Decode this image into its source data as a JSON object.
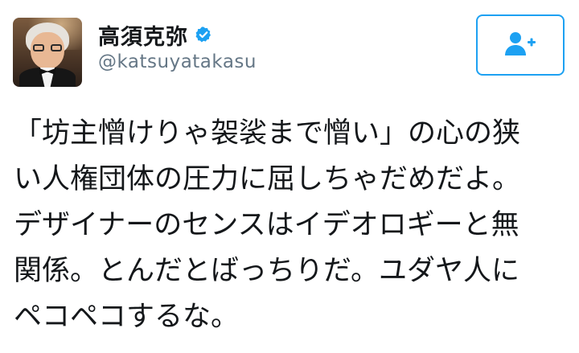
{
  "user": {
    "display_name": "高須克弥",
    "handle": "@katsuyatakasu",
    "verified": true,
    "avatar_icon": "profile-photo"
  },
  "follow_button": {
    "icon": "follow-user-plus-icon",
    "color": "#1da1f2"
  },
  "tweet": {
    "lines": [
      "「坊主憎けりゃ袈裟まで憎い」の心の狭",
      "い人権団体の圧力に屈しちゃだめだよ。",
      "デザイナーのセンスはイデオロギーと無",
      "関係。とんだとばっちりだ。ユダヤ人に",
      "ペコペコするな。"
    ]
  },
  "colors": {
    "accent": "#1da1f2",
    "text": "#14171a",
    "secondary_text": "#657786"
  }
}
